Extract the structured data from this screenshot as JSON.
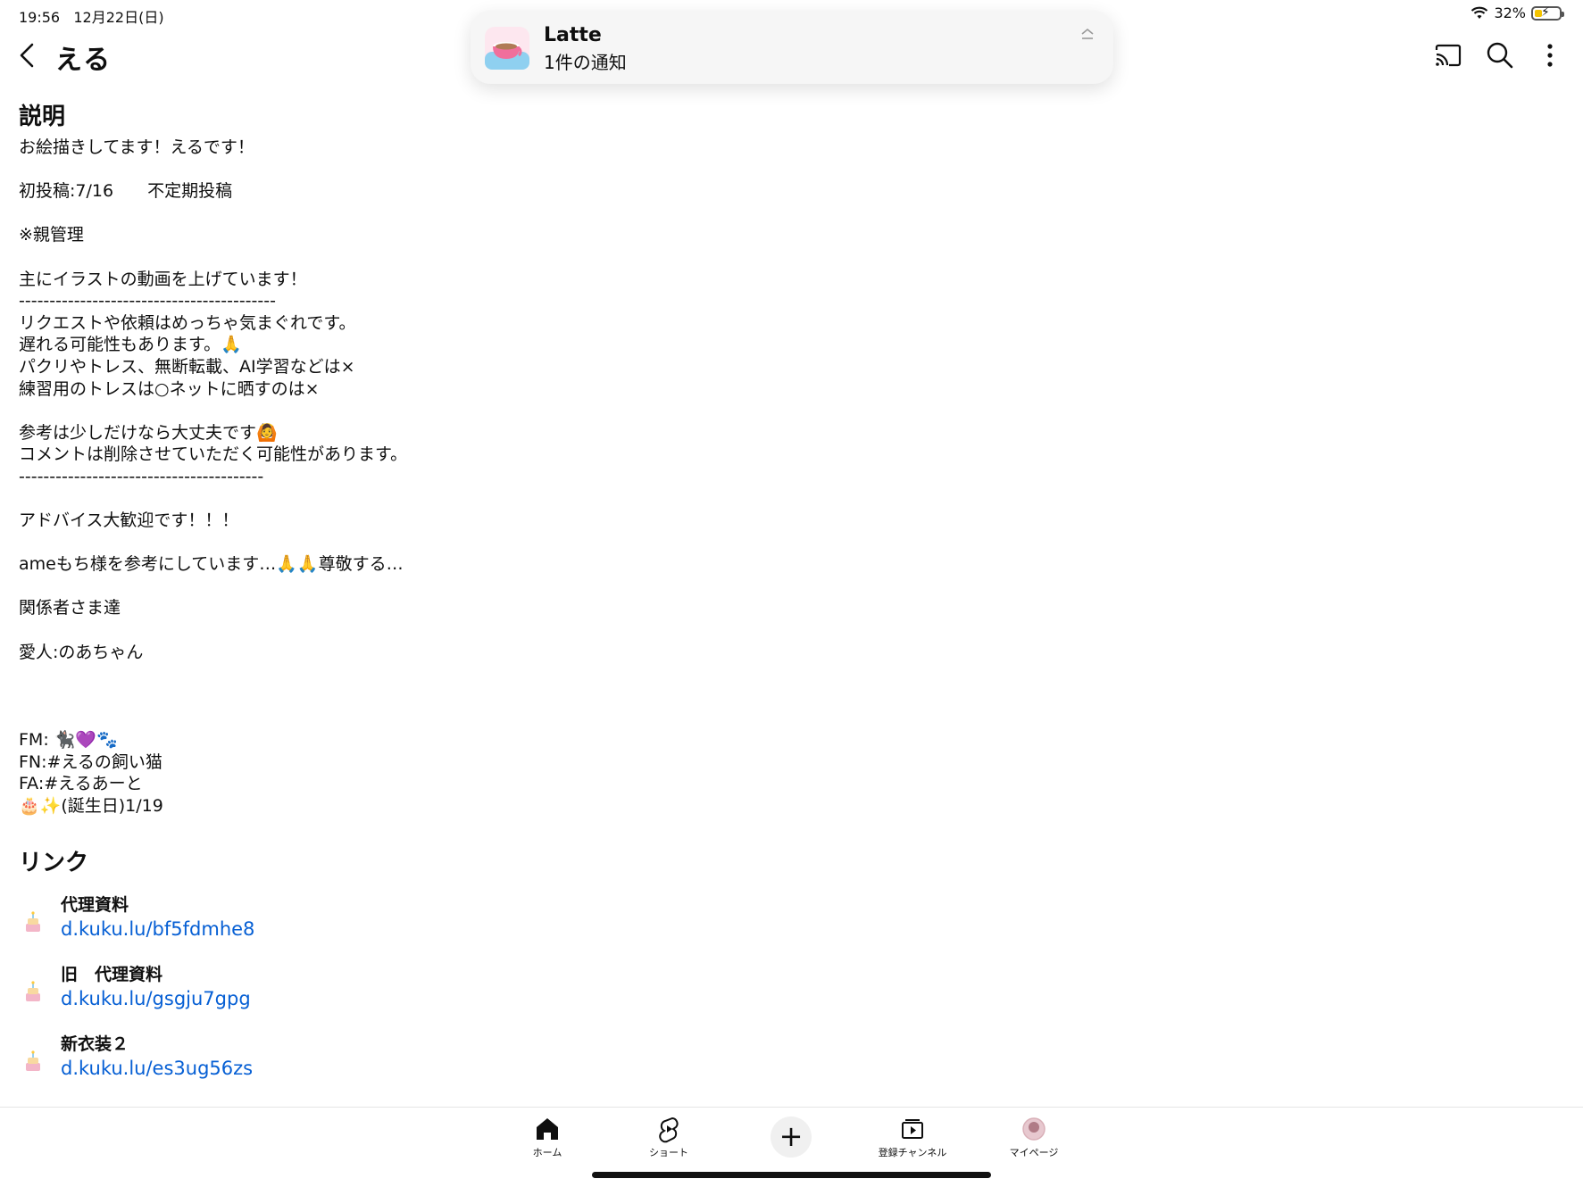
{
  "status": {
    "time": "19:56",
    "date": "12月22日(日)",
    "battery": "32%",
    "battery_level": 0.32
  },
  "header": {
    "title": "える"
  },
  "notification": {
    "app": "Latte",
    "message": "1件の通知"
  },
  "about": {
    "heading": "説明",
    "lines": [
      "お絵描きしてます！えるです！",
      "",
      "初投稿:7/16　　不定期投稿",
      "",
      "※親管理",
      "",
      "主にイラストの動画を上げています！",
      "------------------------------------------",
      "リクエストや依頼はめっちゃ気まぐれです。",
      "遅れる可能性もあります。🙏",
      "パクリやトレス、無断転載、AI学習などは×",
      "練習用のトレスは○ネットに晒すのは×",
      "",
      "参考は少しだけなら大丈夫です🙆",
      "コメントは削除させていただく可能性があります。",
      "----------------------------------------",
      "",
      "アドバイス大歓迎です！！！",
      "",
      "ameもち様を参考にしています…🙏🙏尊敬する…",
      "",
      "関係者さま達",
      "",
      "愛人:のあちゃん",
      "",
      "",
      "",
      "FM: 🐈‍⬛💜🐾",
      "FN:#えるの飼い猫",
      "FA:#えるあーと",
      "🎂✨(誕生日)1/19"
    ]
  },
  "links": {
    "heading": "リンク",
    "items": [
      {
        "title": "代理資料",
        "url": "d.kuku.lu/bf5fdmhe8"
      },
      {
        "title": "旧　代理資料",
        "url": "d.kuku.lu/gsgju7gpg"
      },
      {
        "title": "新衣装２",
        "url": "d.kuku.lu/es3ug56zs"
      }
    ]
  },
  "nav": {
    "home": "ホーム",
    "shorts": "ショート",
    "create": "+",
    "subscriptions": "登録チャンネル",
    "mypage": "マイページ"
  }
}
